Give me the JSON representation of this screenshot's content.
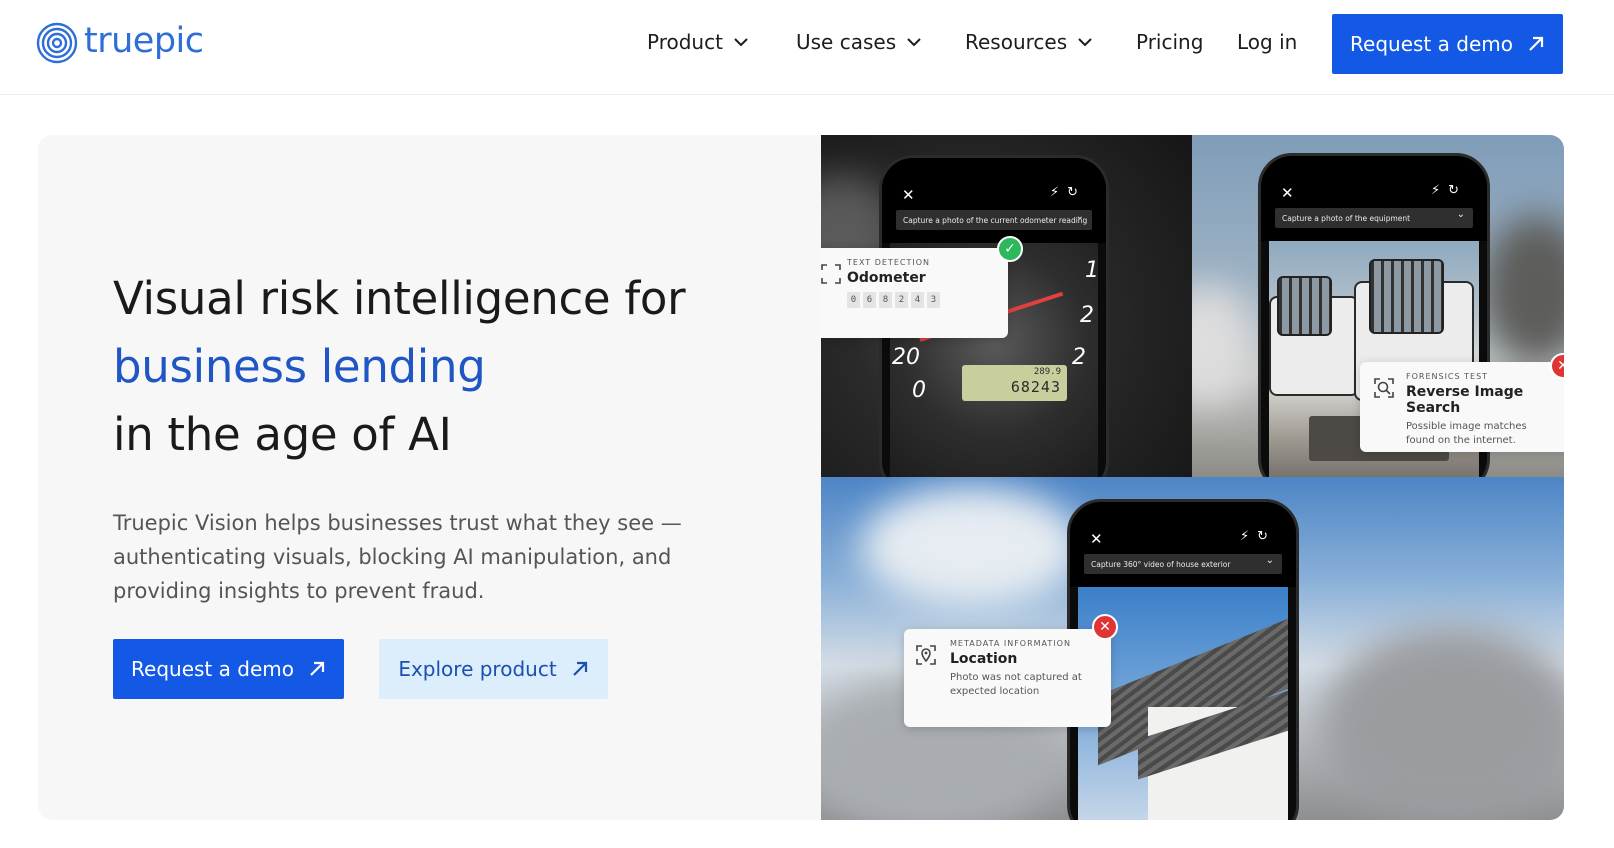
{
  "brand": {
    "name": "truepic",
    "logo_color": "#2d6fd6"
  },
  "nav": {
    "items": [
      {
        "label": "Product",
        "has_dropdown": true
      },
      {
        "label": "Use cases",
        "has_dropdown": true
      },
      {
        "label": "Resources",
        "has_dropdown": true
      },
      {
        "label": "Pricing",
        "has_dropdown": false
      },
      {
        "label": "Log in",
        "has_dropdown": false
      }
    ],
    "cta_label": "Request a demo"
  },
  "hero": {
    "headline_line1": "Visual risk intelligence for",
    "headline_line2": "business lending",
    "headline_line3": "in the age of AI",
    "subtext": "Truepic Vision helps businesses trust what they see — authenticating visuals, blocking AI manipulation, and providing insights to prevent fraud.",
    "primary_cta": "Request a demo",
    "secondary_cta": "Explore product"
  },
  "panels": {
    "odometer": {
      "prompt": "Capture a photo of the current odometer reading",
      "lcd_top": "289.9",
      "lcd_main": "68243",
      "card_kicker": "TEXT DETECTION",
      "card_title": "Odometer",
      "digits": [
        "0",
        "6",
        "8",
        "2",
        "4",
        "3"
      ],
      "gauge_labels": [
        "20",
        "0",
        "1",
        "2",
        "2"
      ],
      "status": "ok"
    },
    "equipment": {
      "prompt": "Capture a photo of the equipment",
      "card_kicker": "FORENSICS TEST",
      "card_title": "Reverse Image Search",
      "card_desc": "Possible image matches found on the internet.",
      "status": "error"
    },
    "house": {
      "prompt": "Capture 360° video of house exterior",
      "card_kicker": "METADATA INFORMATION",
      "card_title": "Location",
      "card_desc": "Photo was not captured at expected location",
      "status": "error"
    }
  },
  "colors": {
    "primary": "#1459e6",
    "accent_text": "#1f55c4",
    "secondary_bg": "#dcedfb",
    "success": "#2eb85c",
    "error": "#e03535"
  }
}
